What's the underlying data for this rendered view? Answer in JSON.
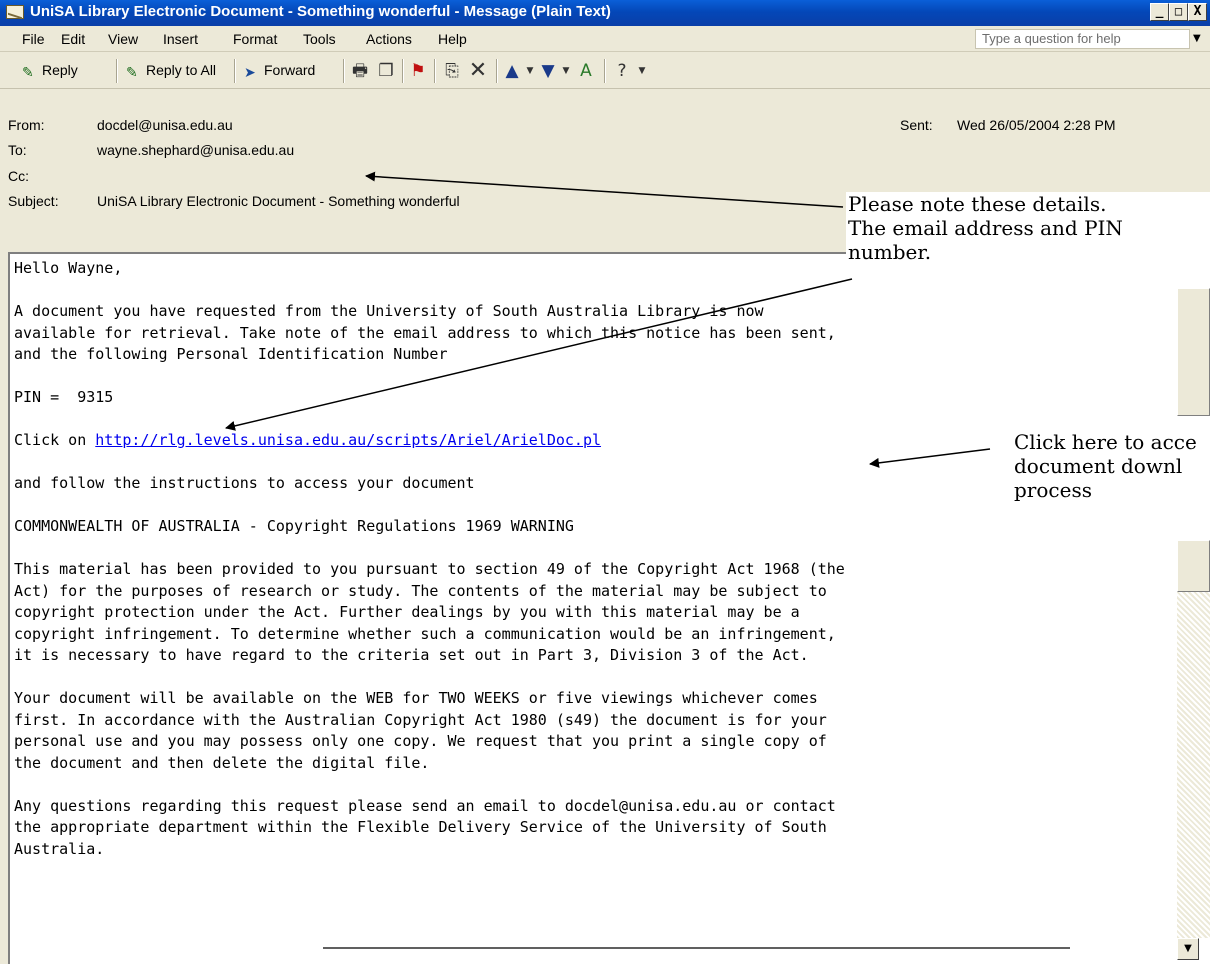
{
  "window": {
    "title": "UniSA Library Electronic Document - Something wonderful - Message (Plain Text)",
    "minimize": "_",
    "maximize": "□",
    "close": "X"
  },
  "menu": {
    "items": [
      "File",
      "Edit",
      "View",
      "Insert",
      "Format",
      "Tools",
      "Actions",
      "Help"
    ],
    "help_placeholder": "Type a question for help"
  },
  "toolbar": {
    "reply": "Reply",
    "reply_all": "Reply to All",
    "forward": "Forward"
  },
  "header": {
    "from_label": "From:",
    "from_value": "docdel@unisa.edu.au",
    "to_label": "To:",
    "to_value": "wayne.shephard@unisa.edu.au",
    "cc_label": "Cc:",
    "cc_value": "",
    "subject_label": "Subject:",
    "subject_value": "UniSA Library Electronic Document - Something wonderful",
    "sent_label": "Sent:",
    "sent_value": "Wed 26/05/2004 2:28 PM"
  },
  "body": {
    "l1": "Hello Wayne,",
    "l2": "A document you have requested from the University of South Australia Library is now",
    "l3": "available for retrieval. Take note of the email address to which this notice has been sent,",
    "l4": "and the following Personal Identification Number",
    "l5": "PIN =  9315",
    "l6_prefix": "Click on ",
    "l6_link": "http://rlg.levels.unisa.edu.au/scripts/Ariel/ArielDoc.pl",
    "l7": "and follow the instructions to access your document",
    "l8": "COMMONWEALTH OF AUSTRALIA - Copyright Regulations 1969 WARNING",
    "l9": "This material has been provided to you pursuant to section 49 of the Copyright Act 1968 (the",
    "l10": "Act) for the purposes of research or study. The contents of the material may be subject to",
    "l11": "copyright protection under the Act. Further dealings by you with this material may be a",
    "l12": "copyright infringement. To determine whether such a communication would be an infringement,",
    "l13": "it is necessary to have regard to the criteria set out in Part 3, Division 3 of the Act.",
    "l14": "Your document will be available on the WEB for TWO WEEKS or five viewings whichever comes",
    "l15": "first. In accordance with the Australian Copyright Act 1980 (s49) the document is for your",
    "l16": "personal use and you may possess only one copy. We request that you print a single copy of",
    "l17": "the document and then delete the digital file.",
    "l18": "Any questions regarding this request please send an email to docdel@unisa.edu.au or contact",
    "l19": "the appropriate department within the Flexible Delivery Service of the University of South",
    "l20": "Australia."
  },
  "callouts": {
    "note_l1": "Please note these details.",
    "note_l2": "The email address and PIN",
    "note_l3": "number.",
    "click_l1": "Click here to acce",
    "click_l2": "document downl",
    "click_l3": "process"
  },
  "icons": [
    "envelope-icon",
    "reply-icon",
    "reply-all-icon",
    "forward-icon",
    "print-icon",
    "copy-icon",
    "flag-icon",
    "move-icon",
    "delete-icon",
    "up-arrow-icon",
    "down-arrow-icon",
    "address-book-icon",
    "help-icon"
  ]
}
